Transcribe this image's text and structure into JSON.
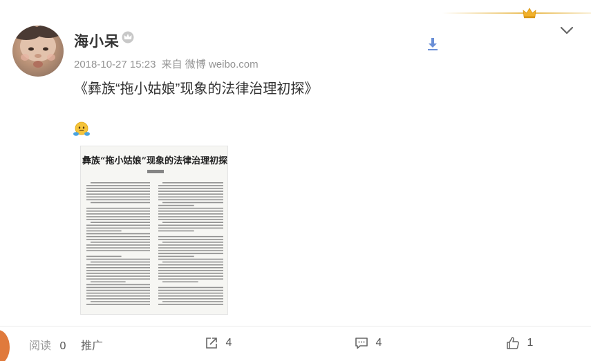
{
  "post": {
    "username": "海小呆",
    "timestamp": "2018-10-27 15:23",
    "source": "来自 微博 weibo.com",
    "text": "《彝族“拖小姑娘”现象的法律治理初探》"
  },
  "article_image": {
    "title": "彝族“拖小姑娘”现象的法律治理初探"
  },
  "footer": {
    "read_label": "阅读",
    "read_count": "0",
    "promote_label": "推广",
    "share_count": "4",
    "comment_count": "4",
    "like_count": "1"
  },
  "colors": {
    "gold_accent": "#e8b84a",
    "muted_text": "#939393",
    "download_blue": "#6a8fd6"
  },
  "icons": [
    "crown-icon",
    "chevron-down-icon",
    "badge-icon",
    "download-icon",
    "emoji-icon",
    "share-icon",
    "comment-icon",
    "like-icon"
  ]
}
